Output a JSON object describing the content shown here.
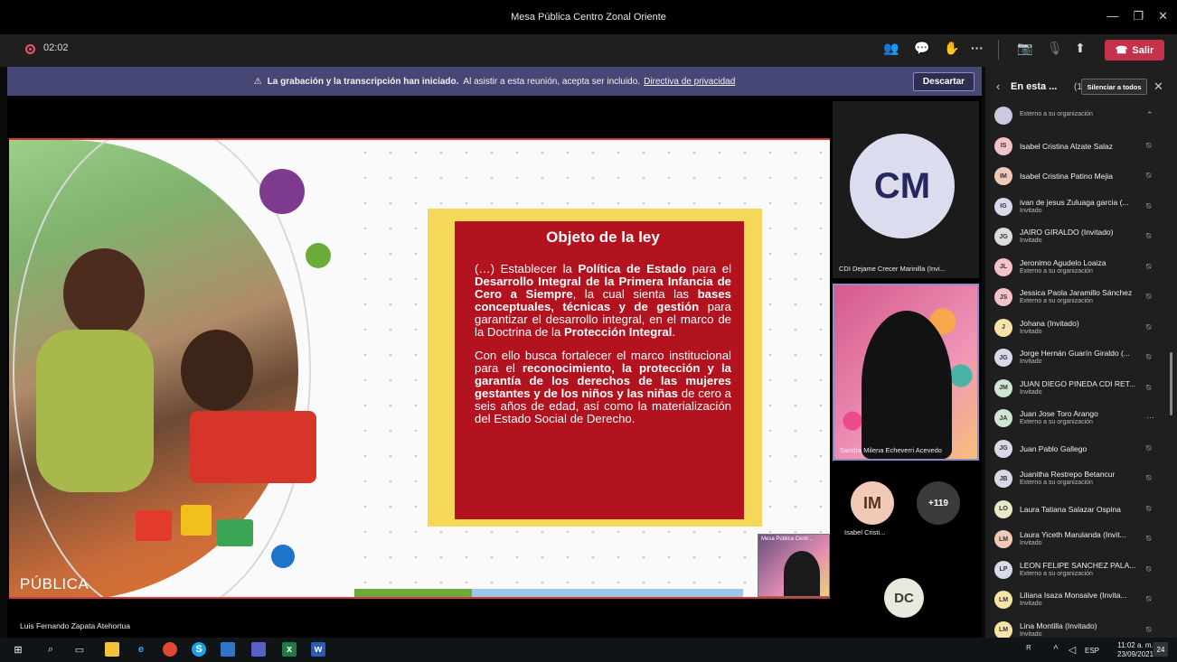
{
  "window": {
    "title": "Mesa Pública Centro Zonal Oriente"
  },
  "meeting": {
    "timer": "02:02",
    "leave_label": "Salir",
    "toolbar_icons": [
      "participants-icon",
      "chat-icon",
      "reactions-icon",
      "more-icon",
      "camera-off-icon",
      "mic-off-icon",
      "share-icon"
    ]
  },
  "banner": {
    "bold": "La grabación y la transcripción han iniciado.",
    "text": "Al asistir a esta reunión, acepta ser incluido.",
    "link": "Directiva de privacidad",
    "dismiss": "Descartar"
  },
  "slide": {
    "title": "Objeto de la ley",
    "brand": "PÚBLICA",
    "p1": [
      {
        "t": "(…) Establecer la ",
        "b": false
      },
      {
        "t": "Política de Estado",
        "b": true
      },
      {
        "t": " para el ",
        "b": false
      },
      {
        "t": "Desarrollo Integral de la Primera Infancia de Cero a Siempre",
        "b": true
      },
      {
        "t": ", la cual sienta las ",
        "b": false
      },
      {
        "t": "bases conceptuales, técnicas y de gestión",
        "b": true
      },
      {
        "t": " para garantizar el desarrollo integral, en el marco de la Doctrina de la ",
        "b": false
      },
      {
        "t": "Protección Integral",
        "b": true
      },
      {
        "t": ".",
        "b": false
      }
    ],
    "p2": [
      {
        "t": "Con ello busca fortalecer el marco institucional para el ",
        "b": false
      },
      {
        "t": "reconocimiento, la protección y la garantía de los derechos de las mujeres gestantes y de los niños y las niñas",
        "b": true
      },
      {
        "t": " de cero a seis años de edad, así como la materialización del Estado Social de Derecho.",
        "b": false
      }
    ]
  },
  "pip": {
    "label": "Mesa Pública Centr..."
  },
  "speaker": {
    "name": "Luis Fernando Zapata Atehortua"
  },
  "roster": {
    "cm": {
      "initials": "CM",
      "name": "CDI Dejame Crecer Marinilla (Invi..."
    },
    "video": {
      "name": "Sandra Milena Echeverri Acevedo"
    },
    "im": {
      "initials": "IM",
      "name": "Isabel Cristi..."
    },
    "more": "+119",
    "dc": {
      "initials": "DC"
    }
  },
  "panel": {
    "title": "En esta ...",
    "count": "(123)",
    "mute_all": "Silenciar a todos",
    "participants": [
      {
        "initials": "",
        "name": "",
        "sub": "Externo a su organización",
        "color": "#c9c9e0"
      },
      {
        "initials": "IS",
        "name": "Isabel Cristina Alzate Salaz",
        "sub": "",
        "color": "#f3c3c7"
      },
      {
        "initials": "IM",
        "name": "Isabel Cristina Patino Mejia",
        "sub": "",
        "color": "#f1c9b7"
      },
      {
        "initials": "IG",
        "name": "ivan de jesus Zuluaga garcia (...",
        "sub": "Invitado",
        "color": "#d9d9ec"
      },
      {
        "initials": "JG",
        "name": "JAIRO GIRALDO (Invitado)",
        "sub": "Invitado",
        "color": "#dcdcdc"
      },
      {
        "initials": "JL",
        "name": "Jeronimo Agudelo Loaiza",
        "sub": "Externo a su organización",
        "color": "#f3c3c7"
      },
      {
        "initials": "JS",
        "name": "Jessica Paola Jaramillo Sánchez",
        "sub": "Externo a su organización",
        "color": "#f3c3c7"
      },
      {
        "initials": "J",
        "name": "Johana (Invitado)",
        "sub": "Invitado",
        "color": "#f7e3a6"
      },
      {
        "initials": "JG",
        "name": "Jorge Hernán Guarín Giraldo (...",
        "sub": "Invitado",
        "color": "#d9d9ec"
      },
      {
        "initials": "JM",
        "name": "JUAN DIEGO PINEDA CDI RET...",
        "sub": "Invitado",
        "color": "#cfe6d3"
      },
      {
        "initials": "JA",
        "name": "Juan Jose Toro Arango",
        "sub": "Externo a su organización",
        "color": "#cfe6d3"
      },
      {
        "initials": "JG",
        "name": "Juan Pablo Gallego",
        "sub": "",
        "color": "#d9d9ec"
      },
      {
        "initials": "JB",
        "name": "Juanitha Restrepo Betancur",
        "sub": "Externo a su organización",
        "color": "#d9d9ec"
      },
      {
        "initials": "LO",
        "name": "Laura Tatiana Salazar Ospina",
        "sub": "",
        "color": "#e8e9c9"
      },
      {
        "initials": "LM",
        "name": "Laura Yiceth Marulanda (Invit...",
        "sub": "Invitado",
        "color": "#f1c9b7"
      },
      {
        "initials": "LP",
        "name": "LEON FELIPE SANCHEZ PALA...",
        "sub": "Externo a su organización",
        "color": "#d9d9ec"
      },
      {
        "initials": "LM",
        "name": "Liliana Isaza Monsalve (Invita...",
        "sub": "Invitado",
        "color": "#f7e3a6"
      },
      {
        "initials": "LM",
        "name": "Lina Montilla (Invitado)",
        "sub": "Invitado",
        "color": "#f7e3a6"
      }
    ]
  },
  "taskbar": {
    "lang": "ESP",
    "time": "11:02 a. m.",
    "date": "23/09/2021",
    "notifications": "24"
  }
}
